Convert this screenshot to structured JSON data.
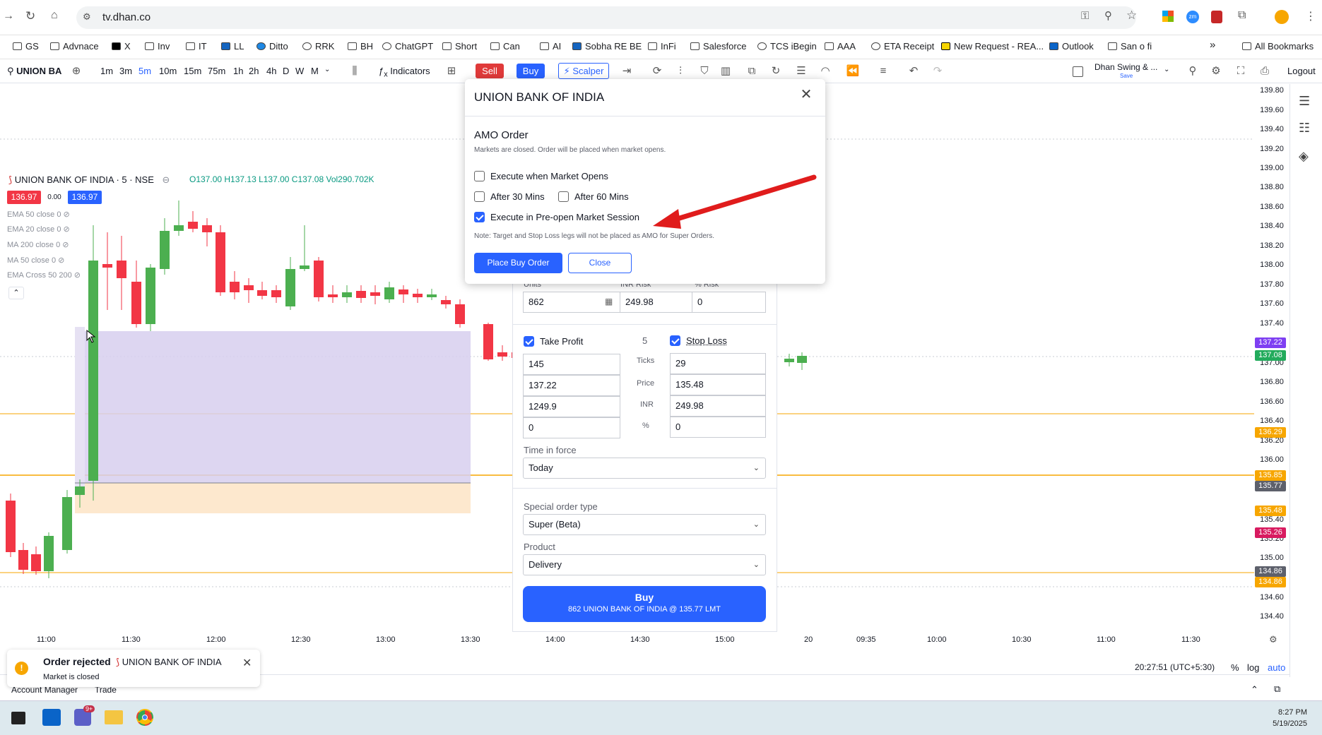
{
  "browser": {
    "url": "tv.dhan.co",
    "bookmarks": [
      "GS",
      "Advnace",
      "X",
      "Inv",
      "IT",
      "LL",
      "Ditto",
      "RRK",
      "BH",
      "ChatGPT",
      "Short",
      "Can",
      "AI",
      "Sobha RE BE",
      "InFi",
      "Salesforce",
      "TCS iBegin",
      "AAA",
      "ETA Receipt",
      "New Request - REA...",
      "Outlook",
      "San o fi"
    ],
    "all_bookmarks": "All Bookmarks",
    "more": "»"
  },
  "toolbar": {
    "symbol": "UNION BA",
    "intervals": [
      "1m",
      "3m",
      "5m",
      "10m",
      "15m",
      "75m",
      "1h",
      "2h",
      "4h",
      "D",
      "W",
      "M"
    ],
    "active_interval": "5m",
    "indicators": "Indicators",
    "sell": "Sell",
    "buy": "Buy",
    "scalper": "Scalper",
    "layout_name": "Dhan Swing & ...",
    "layout_save": "Save",
    "logout": "Logout"
  },
  "chart": {
    "title": "UNION BANK OF INDIA · 5 · NSE",
    "ohlc": "O137.00 H137.13 L137.00 C137.08 Vol290.702K",
    "bid": "136.97",
    "spread": "0.00",
    "ask": "136.97",
    "indicators": [
      "EMA 50 close 0",
      "EMA 20 close 0",
      "MA 200 close 0",
      "MA 50 close 0",
      "EMA Cross 50 200"
    ],
    "price_axis": [
      "139.80",
      "139.60",
      "139.40",
      "139.20",
      "139.00",
      "138.80",
      "138.60",
      "138.40",
      "138.20",
      "138.00",
      "137.80",
      "137.60",
      "137.40",
      "137.00",
      "136.80",
      "136.60",
      "136.40",
      "136.20",
      "136.00",
      "135.40",
      "135.20",
      "135.00",
      "134.60",
      "134.40"
    ],
    "price_tags": [
      {
        "label": "137.22",
        "color": "#7e3ff2"
      },
      {
        "label": "137.08",
        "color": "#22ab5c"
      },
      {
        "label": "136.29",
        "color": "#f7a600"
      },
      {
        "label": "135.85",
        "color": "#f7a600"
      },
      {
        "label": "135.77",
        "color": "#5d606b"
      },
      {
        "label": "135.48",
        "color": "#f7a600"
      },
      {
        "label": "135.26",
        "color": "#d81b60"
      },
      {
        "label": "134.86",
        "color": "#5d606b"
      },
      {
        "label": "134.86",
        "color": "#f7a600"
      }
    ],
    "time_axis": [
      "11:00",
      "11:30",
      "12:00",
      "12:30",
      "13:00",
      "13:30",
      "14:00",
      "14:30",
      "15:00",
      "20",
      "09:35",
      "10:00",
      "10:30",
      "11:00",
      "11:30"
    ],
    "clock": "20:27:51 (UTC+5:30)",
    "percent": "%",
    "log": "log",
    "auto": "auto"
  },
  "amo_modal": {
    "title": "UNION BANK OF INDIA",
    "heading": "AMO Order",
    "subtitle": "Markets are closed. Order will be placed when market opens.",
    "opt_market_open": "Execute when Market Opens",
    "opt_30": "After 30 Mins",
    "opt_60": "After 60 Mins",
    "opt_preopen": "Execute in Pre-open Market Session",
    "note": "Note: Target and Stop Loss legs will not be placed as AMO for Super Orders.",
    "place_button": "Place Buy Order",
    "close_button": "Close",
    "checked": {
      "market_open": false,
      "after30": false,
      "after60": false,
      "preopen": true
    }
  },
  "order_panel": {
    "units_label": "Units",
    "inr_risk_label": "INR Risk",
    "pct_risk_label": "% Risk",
    "units": "862",
    "inr_risk": "249.98",
    "pct_risk": "0",
    "take_profit_label": "Take Profit",
    "ratio": "5",
    "stop_loss_label": "Stop Loss",
    "tp_ticks": "145",
    "tp_price": "137.22",
    "tp_inr": "1249.9",
    "tp_pct": "0",
    "sl_ticks": "29",
    "sl_price": "135.48",
    "sl_inr": "249.98",
    "sl_pct": "0",
    "row_labels": [
      "Ticks",
      "Price",
      "INR",
      "%"
    ],
    "tif_label": "Time in force",
    "tif_value": "Today",
    "special_label": "Special order type",
    "special_value": "Super (Beta)",
    "product_label": "Product",
    "product_value": "Delivery",
    "buy_title": "Buy",
    "buy_detail": "862 UNION BANK OF INDIA @ 135.77 LMT"
  },
  "toast": {
    "title": "Order rejected",
    "symbol": "UNION BANK OF INDIA",
    "message": "Market is closed"
  },
  "bottom": {
    "account_manager": "Account Manager",
    "trade": "Trade"
  },
  "taskbar": {
    "time": "8:27 PM",
    "date": "5/19/2025",
    "badge": "9+"
  }
}
